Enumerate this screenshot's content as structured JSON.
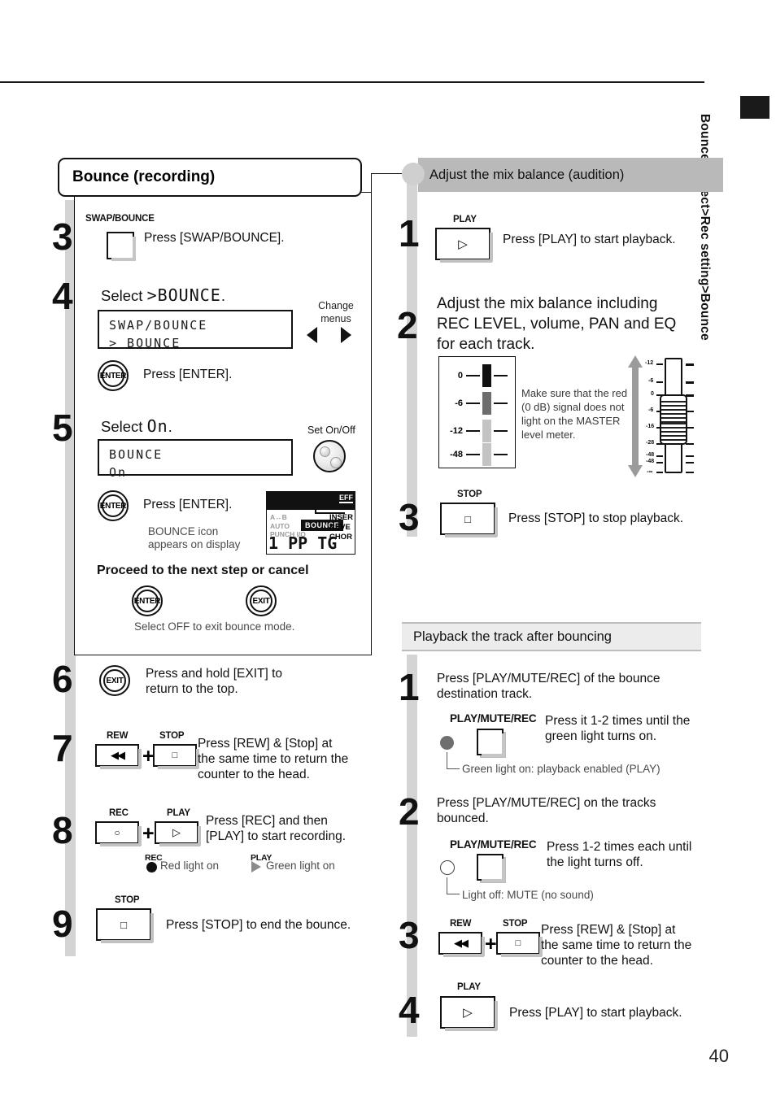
{
  "page": {
    "number": "40",
    "side_tab_label": "Bounce/Project>Rec setting>Bounce"
  },
  "left": {
    "title": "Bounce (recording)",
    "step3": {
      "num": "3",
      "button_cap": "SWAP/BOUNCE",
      "text": "Press [SWAP/BOUNCE]."
    },
    "step4": {
      "num": "4",
      "heading_prefix": "Select ",
      "heading_value": ">BOUNCE",
      "heading_suffix": ".",
      "lcd_line1": "SWAP/BOUNCE",
      "lcd_line2": "> BOUNCE",
      "change_menus": "Change\nmenus",
      "enter_label": "ENTER",
      "enter_text": "Press [ENTER]."
    },
    "step5": {
      "num": "5",
      "heading_prefix": "Select ",
      "heading_value": "On",
      "heading_suffix": ".",
      "knob_label": "Set On/Off",
      "lcd_line1": "BOUNCE",
      "lcd_line2": "On",
      "enter_label": "ENTER",
      "enter_text": "Press [ENTER].",
      "icon_note_l1": "BOUNCE icon",
      "icon_note_l2": "appears on display",
      "display": {
        "eff": "EFF",
        "left_l1": "A↔B",
        "left_l2": "AUTO",
        "left_l3": "PUNCH I/O",
        "badge": "BOUNCE",
        "right_l1": "INSER",
        "right_l2": "REVE",
        "right_l3": "CHOR",
        "counter": "1  PP TG"
      }
    },
    "proceed": {
      "heading": "Proceed to the next step or cancel",
      "enter_label": "ENTER",
      "exit_label": "EXIT",
      "note": "Select OFF to exit bounce mode."
    },
    "step6": {
      "num": "6",
      "exit_label": "EXIT",
      "text_l1": "Press and hold [EXIT] to",
      "text_l2": "return to the top."
    },
    "step7": {
      "num": "7",
      "cap1": "REW",
      "cap2": "STOP",
      "plus": "+",
      "text_l1": "Press [REW] & [Stop] at",
      "text_l2": "the same time to return the",
      "text_l3": "counter to the head."
    },
    "step8": {
      "num": "8",
      "cap1": "REC",
      "cap2": "PLAY",
      "plus": "+",
      "text_l1": "Press [REC] and then",
      "text_l2": "[PLAY] to start recording.",
      "led1_cap": "REC",
      "led1_text": "Red light on",
      "led2_cap": "PLAY",
      "led2_text": "Green light on"
    },
    "step9": {
      "num": "9",
      "cap": "STOP",
      "text": "Press [STOP] to end the bounce."
    }
  },
  "right": {
    "section1": {
      "header": "Adjust the mix balance (audition)",
      "step1": {
        "num": "1",
        "cap": "PLAY",
        "text": "Press [PLAY] to start playback."
      },
      "step2": {
        "num": "2",
        "text_l1": "Adjust the mix balance including",
        "text_l2": "REC LEVEL, volume, PAN and EQ",
        "text_l3": "for each track.",
        "meter_labels": [
          "0",
          "-6",
          "-12",
          "-48"
        ],
        "note_l1": "Make sure that the red",
        "note_l2": "(0 dB) signal does not",
        "note_l3": "light on the MASTER",
        "note_l4": "level meter.",
        "fader_ticks": [
          "-12",
          "-6",
          "0",
          "-6",
          "-16",
          "-28",
          "-48",
          "-48",
          "-∞"
        ]
      },
      "step3": {
        "num": "3",
        "cap": "STOP",
        "text": "Press [STOP] to stop playback."
      }
    },
    "section2": {
      "header": "Playback the track after bouncing",
      "step1": {
        "num": "1",
        "text_l1": "Press [PLAY/MUTE/REC] of the bounce",
        "text_l2": "destination track.",
        "cap": "PLAY/MUTE/REC",
        "note_l1": "Press it 1-2 times until the",
        "note_l2": "green light turns on.",
        "led_note": "Green light on: playback enabled (PLAY)"
      },
      "step2": {
        "num": "2",
        "text_l1": "Press [PLAY/MUTE/REC] on the tracks",
        "text_l2": "bounced.",
        "cap": "PLAY/MUTE/REC",
        "note_l1": "Press 1-2 times each until",
        "note_l2": "the light turns off.",
        "led_note": "Light off: MUTE (no sound)"
      },
      "step3": {
        "num": "3",
        "cap1": "REW",
        "cap2": "STOP",
        "plus": "+",
        "text_l1": "Press [REW] & [Stop] at",
        "text_l2": "the same time to return the",
        "text_l3": "counter to the head."
      },
      "step4": {
        "num": "4",
        "cap": "PLAY",
        "text": "Press [PLAY] to start playback."
      }
    }
  }
}
